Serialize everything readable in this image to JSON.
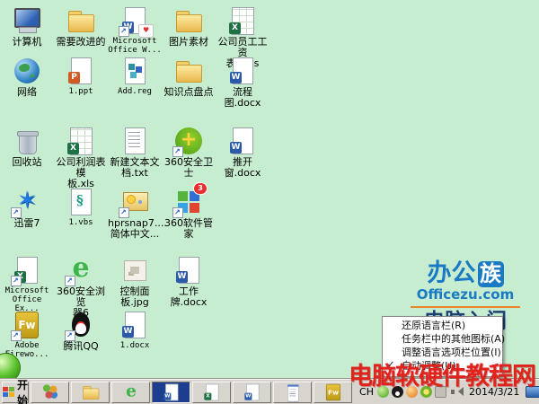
{
  "desktop": {
    "bg_color": "#c7edd0",
    "rows": [
      {
        "items": [
          {
            "label": "计算机",
            "icon": "computer",
            "name": "computer"
          },
          {
            "label": "需要改进的",
            "icon": "folder",
            "name": "folder-needs-improvement"
          },
          {
            "label": "Microsoft\nOffice W...",
            "icon": "word",
            "name": "microsoft-office-word",
            "shortcut": true,
            "shirt": true
          },
          {
            "label": "图片素材",
            "icon": "folder",
            "name": "folder-picture-material"
          },
          {
            "label": "公司员工工资\n表1.xls",
            "icon": "sheet",
            "name": "company-salary-sheet-xls"
          }
        ]
      },
      {
        "items": [
          {
            "label": "网络",
            "icon": "globe",
            "name": "network"
          },
          {
            "label": "1.ppt",
            "icon": "ppt",
            "name": "ppt-file-1"
          },
          {
            "label": "Add.reg",
            "icon": "reg",
            "name": "add-reg"
          },
          {
            "label": "知识点盘点",
            "icon": "folder",
            "name": "folder-knowledge-points"
          },
          {
            "label": "流程图.docx",
            "icon": "word",
            "name": "flowchart-docx"
          }
        ]
      },
      {
        "items": [
          {
            "label": "回收站",
            "icon": "recycle",
            "name": "recycle-bin"
          },
          {
            "label": "公司利润表模\n板.xls",
            "icon": "sheet",
            "name": "company-profit-template-xls"
          },
          {
            "label": "新建文本文\n档.txt",
            "icon": "txt",
            "name": "new-text-document-txt"
          },
          {
            "label": "360安全卫士",
            "icon": "s360",
            "name": "360-safe-guard",
            "shortcut": true
          },
          {
            "label": "推开窗.docx",
            "icon": "word",
            "name": "tuikaichuang-docx"
          }
        ]
      },
      {
        "items": [
          {
            "label": "迅雷7",
            "icon": "thunder",
            "name": "thunder-7",
            "shortcut": true
          },
          {
            "label": "1.vbs",
            "icon": "vbs",
            "name": "vbs-file-1"
          },
          {
            "label": "hprsnap7....\n简体中文...",
            "icon": "snap",
            "name": "hprsnap7",
            "shortcut": true
          },
          {
            "label": "360软件管家",
            "icon": "sw",
            "name": "360-software-manager",
            "shortcut": true,
            "badge": "3"
          }
        ]
      },
      {
        "items": [
          {
            "label": "Microsoft\nOffice Ex...",
            "icon": "excel",
            "name": "microsoft-office-excel",
            "shortcut": true
          },
          {
            "label": "360安全浏览\n器6",
            "icon": "b360",
            "name": "360-secure-browser-6",
            "shortcut": true
          },
          {
            "label": "控制面板.jpg",
            "icon": "jpg",
            "name": "control-panel-jpg"
          },
          {
            "label": "工作牌.docx",
            "icon": "word",
            "name": "work-badge-docx"
          }
        ]
      },
      {
        "items": [
          {
            "label": "Adobe\nFirewo...",
            "icon": "fw",
            "name": "adobe-fireworks",
            "shortcut": true
          },
          {
            "label": "腾讯QQ",
            "icon": "qq",
            "name": "tencent-qq",
            "shortcut": true
          },
          {
            "label": "1.docx",
            "icon": "word",
            "name": "docx-file-1"
          }
        ]
      }
    ]
  },
  "logo": {
    "brand": "办公",
    "badge": "族",
    "domain": "Officezu.com",
    "subtitle": "电脑入门",
    "brand_color": "#1b7ac4",
    "rule_color": "#e8872a"
  },
  "red_watermark": "电脑软硬件教程网",
  "red_color": "#e1231d",
  "context_menu": {
    "items": [
      {
        "label": "还原语言栏(R)",
        "checked": false
      },
      {
        "label": "任务栏中的其他图标(A)",
        "checked": false
      },
      {
        "label": "调整语言选项栏位置(I)",
        "checked": false
      },
      {
        "label": "自动调整(U)",
        "checked": true
      }
    ]
  },
  "taskbar": {
    "start_label": "开始",
    "buttons": [
      {
        "name": "color-balls-app",
        "icon": "balls"
      },
      {
        "name": "folder-window",
        "icon": "folder"
      },
      {
        "name": "360-browser-window",
        "icon": "b360"
      },
      {
        "name": "word-window",
        "icon": "word",
        "active": true
      },
      {
        "name": "excel-window",
        "icon": "excel"
      },
      {
        "name": "word-doc-window",
        "icon": "word"
      },
      {
        "name": "notepad-window",
        "icon": "notepad"
      },
      {
        "name": "fireworks-window",
        "icon": "fw"
      }
    ],
    "language_indicator": "CH",
    "tray": [
      {
        "name": "tray-green",
        "cls": "ti-green"
      },
      {
        "name": "tray-qq",
        "cls": "ti-qq"
      },
      {
        "name": "tray-orange",
        "cls": "ti-orange"
      },
      {
        "name": "tray-360",
        "cls": "ti-360t"
      },
      {
        "name": "tray-network-gray",
        "cls": "ti-gray"
      },
      {
        "name": "tray-speaker",
        "cls": "ti-speaker"
      }
    ],
    "date": "2014/3/21"
  }
}
